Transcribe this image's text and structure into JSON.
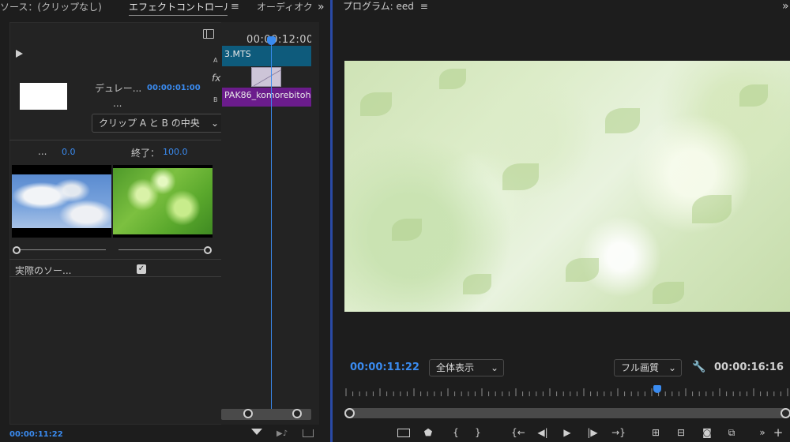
{
  "tabs": {
    "source": "ソース：(クリップなし)",
    "effect_controls": "エフェクトコントロール",
    "effect_menu": "≡",
    "audio": "オーディオク",
    "overflow": "»"
  },
  "effect_controls": {
    "duration_label": "デュレー...",
    "duration_value": "00:00:01:00",
    "duration_ellipsis": "...",
    "alignment": "クリップ A と B の中央",
    "start_label": "...",
    "start_value": "0.0",
    "end_label": "終了：",
    "end_value": "100.0",
    "show_actual_sources_label": "実際のソー...",
    "show_actual_sources_checked": true,
    "current_time": "00:00:11:22"
  },
  "mini_timeline": {
    "timecode": "00:00:12:00",
    "track_a": "A",
    "track_b": "B",
    "fx": "fx",
    "clip_a": "3.MTS",
    "clip_b": "PAK86_komorebitoh"
  },
  "program": {
    "title": "プログラム: eed",
    "title_menu": "≡",
    "overflow": "»",
    "current_time": "00:00:11:22",
    "zoom": "全体表示",
    "quality": "フル画質",
    "duration": "00:00:16:16",
    "playhead_fraction": 0.703
  },
  "colors": {
    "accent": "#3a8bf0",
    "clip_a": "#0e5b7c",
    "clip_b": "#6b1c8c",
    "panel_divider": "#2a4aa6"
  },
  "icons": {
    "panel_toggle": "panel-toggle-icon",
    "play": "play-icon",
    "filter": "filter-icon",
    "play_audio": "play-audio-icon",
    "export": "export-icon",
    "wrench": "wrench-icon",
    "transport": [
      "safe-margins-icon",
      "marker-icon",
      "mark-in-icon",
      "mark-out-icon",
      "go-to-in-icon",
      "step-back-icon",
      "play-icon",
      "step-forward-icon",
      "go-to-out-icon",
      "lift-icon",
      "extract-icon",
      "camera-icon",
      "compare-icon",
      "overflow-icon",
      "add-button-icon"
    ]
  }
}
